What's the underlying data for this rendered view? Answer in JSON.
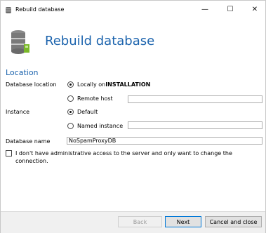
{
  "window": {
    "title": "Rebuild database",
    "controls": {
      "minimize": "—",
      "maximize": "☐",
      "close": "✕"
    }
  },
  "header": {
    "title": "Rebuild database",
    "icon": "database-icon"
  },
  "location": {
    "section_title": "Location",
    "database_location_label": "Database location",
    "local_prefix": "Locally on ",
    "local_host": "INSTALLATION",
    "local_checked": true,
    "remote_label": "Remote host",
    "remote_checked": false,
    "remote_value": "",
    "instance_label": "Instance",
    "default_label": "Default",
    "default_checked": true,
    "named_label": "Named instance",
    "named_checked": false,
    "named_value": "",
    "database_name_label": "Database name",
    "database_name_value": "NoSpamProxyDB"
  },
  "checkbox": {
    "checked": false,
    "label": "I don't have administrative access to the server and only want to change the connection."
  },
  "footer": {
    "back": "Back",
    "back_disabled": true,
    "next": "Next",
    "cancel": "Cancel and close"
  }
}
